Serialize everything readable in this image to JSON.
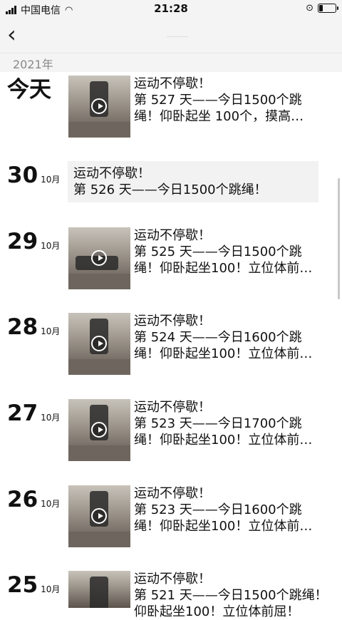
{
  "status_bar": {
    "carrier": "中国电信",
    "time": "21:28"
  },
  "year_label": "2021年",
  "entries": [
    {
      "day": "今天",
      "month": "",
      "lines": [
        "运动不停歇！",
        "第 527 天——今日1500个跳",
        "绳！仰卧起坐 100个，摸高…"
      ],
      "has_video": true
    },
    {
      "day": "30",
      "month": "10月",
      "lines": [
        "运动不停歇！",
        "第 526 天——今日1500个跳绳！"
      ],
      "has_video": false
    },
    {
      "day": "29",
      "month": "10月",
      "lines": [
        "运动不停歇！",
        "第 525 天——今日1500个跳",
        "绳！仰卧起坐100！立位体前…"
      ],
      "has_video": true
    },
    {
      "day": "28",
      "month": "10月",
      "lines": [
        "运动不停歇！",
        "第 524 天——今日1600个跳",
        "绳！仰卧起坐100！立位体前…"
      ],
      "has_video": true
    },
    {
      "day": "27",
      "month": "10月",
      "lines": [
        "运动不停歇！",
        "第 523 天——今日1700个跳",
        "绳！仰卧起坐100！立位体前…"
      ],
      "has_video": true
    },
    {
      "day": "26",
      "month": "10月",
      "lines": [
        "运动不停歇！",
        "第 523 天——今日1600个跳",
        "绳！仰卧起坐100！立位体前…"
      ],
      "has_video": true
    },
    {
      "day": "25",
      "month": "10月",
      "lines": [
        "运动不停歇！",
        "第 521 天——今日1500个跳绳！",
        "仰卧起坐100！立位体前屈！"
      ],
      "has_video": true
    }
  ]
}
